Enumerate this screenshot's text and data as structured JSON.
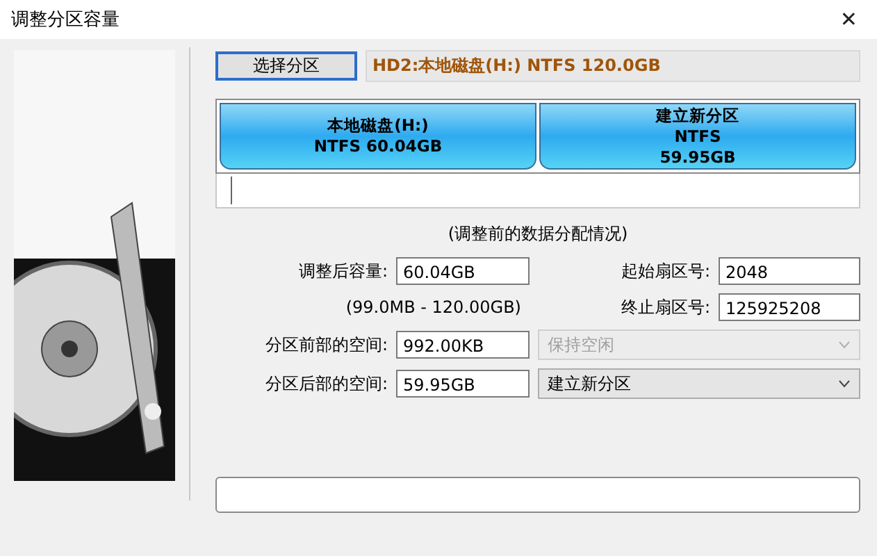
{
  "window": {
    "title": "调整分区容量",
    "close": "✕"
  },
  "select_button": "选择分区",
  "disk_info": "HD2:本地磁盘(H:)  NTFS  120.0GB",
  "partitions": [
    {
      "lines": [
        "本地磁盘(H:)",
        "NTFS 60.04GB"
      ]
    },
    {
      "lines": [
        "建立新分区",
        "NTFS",
        "59.95GB"
      ]
    }
  ],
  "caption": "(调整前的数据分配情况)",
  "size_field": {
    "label": "调整后容量:",
    "value": "60.04GB"
  },
  "size_range": "(99.0MB - 120.00GB)",
  "start_sector": {
    "label": "起始扇区号:",
    "value": "2048"
  },
  "end_sector": {
    "label": "终止扇区号:",
    "value": "125925208"
  },
  "space_rows": [
    {
      "label": "分区前部的空间:",
      "value": "992.00KB",
      "option": "保持空闲",
      "disabled": true
    },
    {
      "label": "分区后部的空间:",
      "value": "59.95GB",
      "option": "建立新分区",
      "disabled": false
    }
  ],
  "progress": {
    "level": 0
  }
}
